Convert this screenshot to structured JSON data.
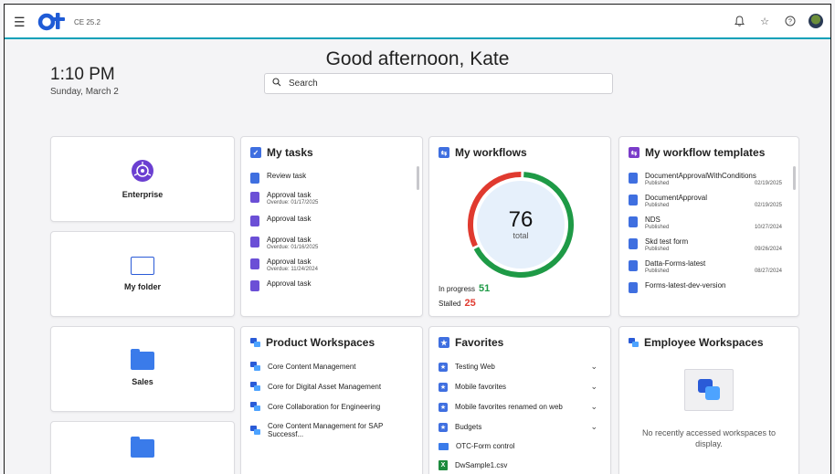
{
  "app": {
    "version": "CE 25.2",
    "accent_color": "#0aa0b8",
    "brand_color": "#1f5bd6"
  },
  "header": {
    "greeting": "Good afternoon, Kate",
    "time": "1:10 PM",
    "date": "Sunday, March 2",
    "search_placeholder": "Search",
    "icons": [
      "menu-icon",
      "bell-icon",
      "star-icon",
      "help-icon",
      "avatar"
    ]
  },
  "tiles": {
    "enterprise": "Enterprise",
    "my_folder": "My folder",
    "sales": "Sales"
  },
  "tasks": {
    "title": "My tasks",
    "items": [
      {
        "name": "Review task",
        "sub": ""
      },
      {
        "name": "Approval task",
        "sub": "Overdue: 01/17/2025"
      },
      {
        "name": "Approval task",
        "sub": ""
      },
      {
        "name": "Approval task",
        "sub": "Overdue: 01/16/2025"
      },
      {
        "name": "Approval task",
        "sub": "Overdue: 11/24/2024"
      },
      {
        "name": "Approval task",
        "sub": ""
      }
    ]
  },
  "workflows": {
    "title": "My workflows",
    "total": "76",
    "total_label": "total",
    "in_progress_label": "In progress",
    "in_progress": 51,
    "stalled_label": "Stalled",
    "stalled": 25,
    "in_progress_color": "#1e9a46",
    "stalled_color": "#e03a2f"
  },
  "templates": {
    "title": "My workflow templates",
    "items": [
      {
        "name": "DocumentApprovalWithConditions",
        "status": "Published",
        "date": "02/19/2025"
      },
      {
        "name": "DocumentApproval",
        "status": "Published",
        "date": "02/19/2025"
      },
      {
        "name": "NDS",
        "status": "Published",
        "date": "10/27/2024"
      },
      {
        "name": "Skd test form",
        "status": "Published",
        "date": "09/26/2024"
      },
      {
        "name": "Datta-Forms-latest",
        "status": "Published",
        "date": "08/27/2024"
      },
      {
        "name": "Forms-latest-dev-version",
        "status": "",
        "date": ""
      }
    ]
  },
  "product_workspaces": {
    "title": "Product Workspaces",
    "items": [
      "Core Content Management",
      "Core for Digital Asset Management",
      "Core Collaboration for Engineering",
      "Core Content Management for SAP Successf..."
    ]
  },
  "favorites": {
    "title": "Favorites",
    "items": [
      {
        "name": "Testing Web",
        "icon": "star-folder-icon",
        "expandable": true
      },
      {
        "name": "Mobile favorites",
        "icon": "star-folder-icon",
        "expandable": true
      },
      {
        "name": "Mobile favorites renamed on web",
        "icon": "star-folder-icon",
        "expandable": true
      },
      {
        "name": "Budgets",
        "icon": "star-folder-icon",
        "expandable": true
      },
      {
        "name": "OTC-Form control",
        "icon": "folder-icon",
        "expandable": false
      },
      {
        "name": "DwSample1.csv",
        "icon": "excel-icon",
        "expandable": false
      }
    ]
  },
  "employee_workspaces": {
    "title": "Employee Workspaces",
    "empty_message": "No recently accessed workspaces to display."
  }
}
